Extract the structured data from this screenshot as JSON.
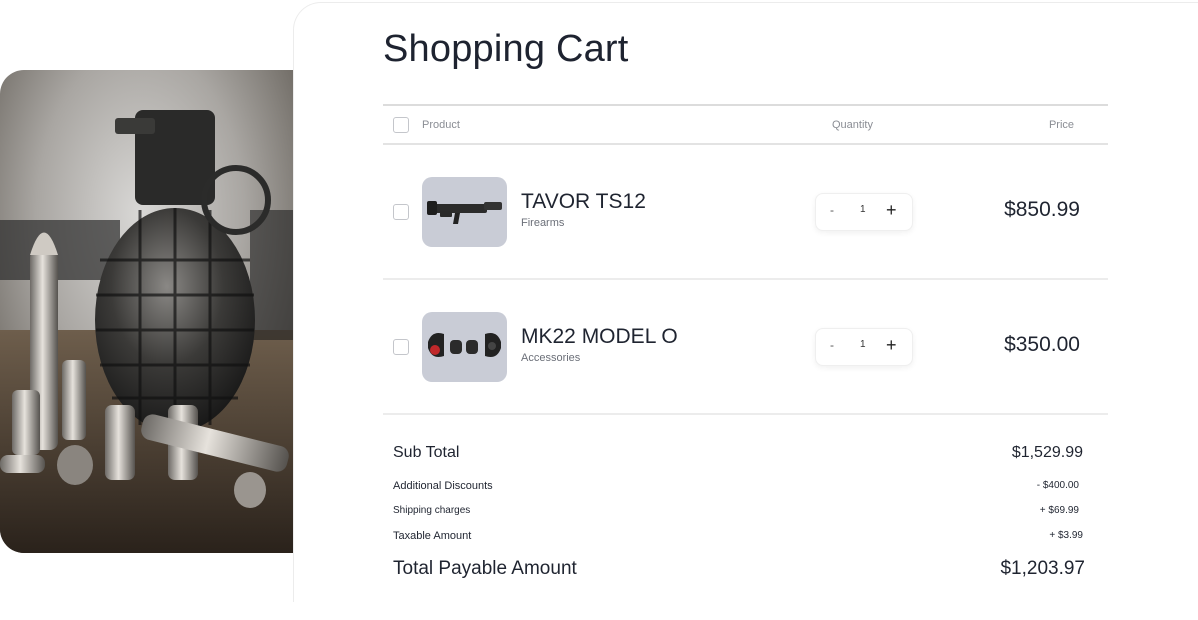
{
  "page": {
    "title": "Shopping Cart"
  },
  "hero": {
    "image": "grenade-and-bullets-photo"
  },
  "table": {
    "headers": {
      "product": "Product",
      "quantity": "Quantity",
      "price": "Price"
    }
  },
  "items": [
    {
      "name": "TAVOR TS12",
      "category": "Firearms",
      "quantity": "1",
      "price": "$850.99",
      "minus": "-",
      "plus": "+",
      "thumbnail": "shotgun-image"
    },
    {
      "name": "MK22 MODEL O",
      "category": "Accessories",
      "quantity": "1",
      "price": "$350.00",
      "minus": "-",
      "plus": "+",
      "thumbnail": "ear-protection-image"
    }
  ],
  "summary": {
    "subtotal_label": "Sub Total",
    "subtotal": "$1,529.99",
    "discount_label": "Additional Discounts",
    "discount": "- $400.00",
    "shipping_label": "Shipping charges",
    "shipping": "+ $69.99",
    "tax_label": "Taxable Amount",
    "tax": "+ $3.99",
    "total_label": "Total Payable Amount",
    "total": "$1,203.97"
  }
}
